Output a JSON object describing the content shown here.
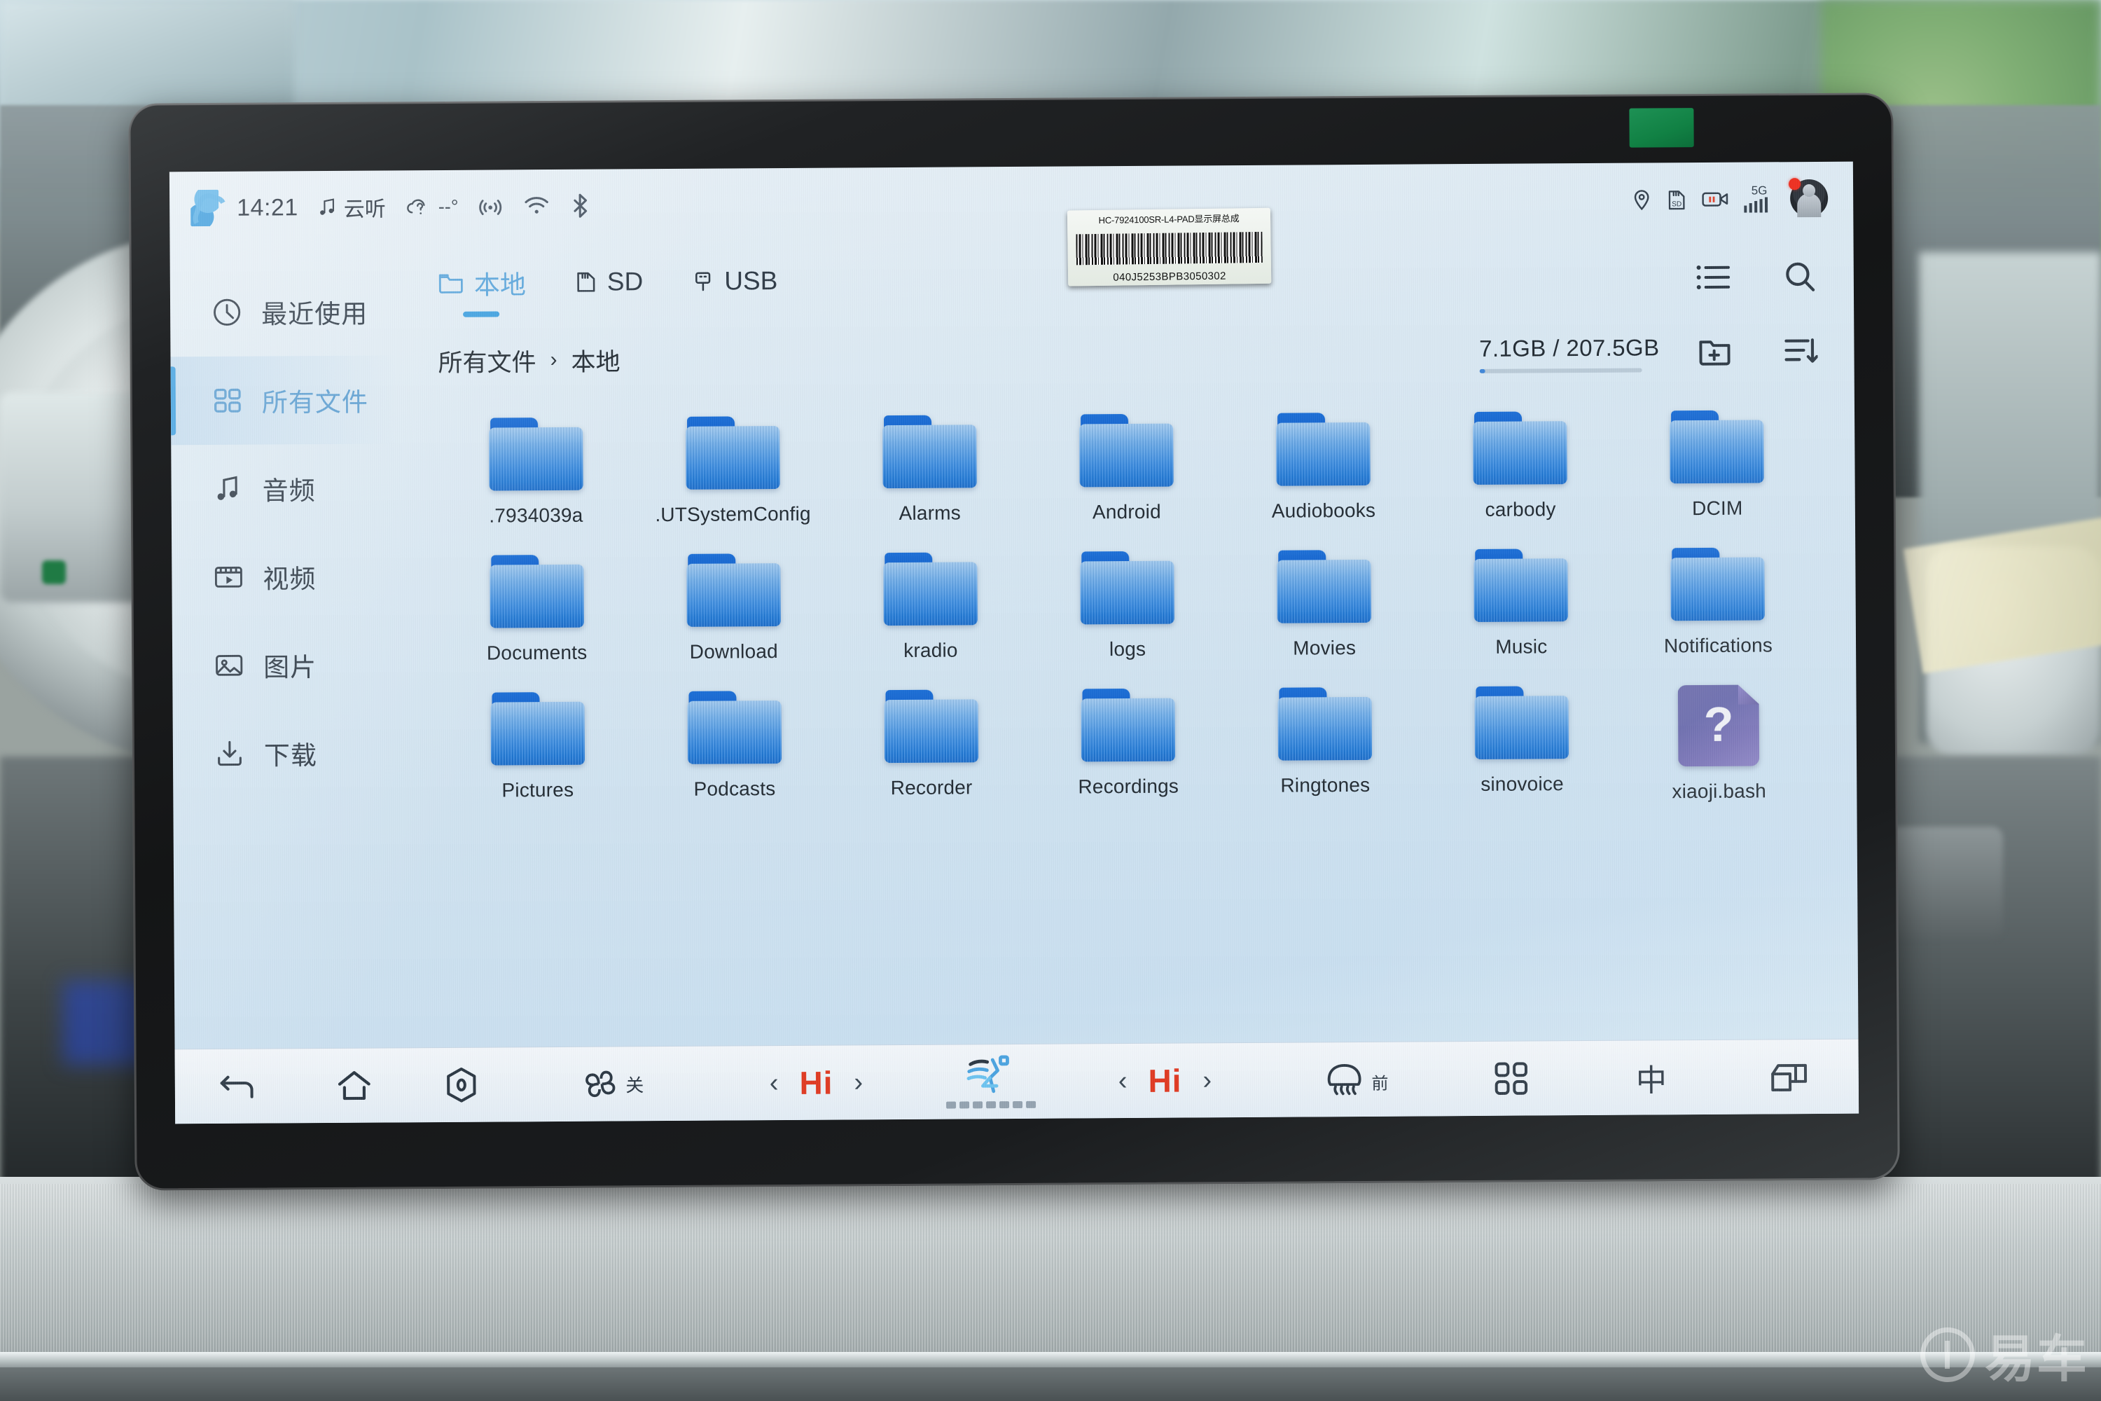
{
  "status_bar": {
    "logo_icon": "s-brand-logo-icon",
    "time": "14:21",
    "music_icon": "music-note-icon",
    "music_label": "云听",
    "weather_icon": "cloud-unknown-icon",
    "temperature": "--°",
    "broadcast_icon": "broadcast-icon",
    "wifi_icon": "wifi-icon",
    "bluetooth_icon": "bluetooth-off-icon",
    "location_icon": "location-pin-icon",
    "sdcard_icon": "sd-card-icon",
    "dashcam_icon": "dashcam-paused-icon",
    "network_label": "5G",
    "signal_icon": "signal-bars-icon",
    "avatar_icon": "user-avatar-icon",
    "avatar_badge": "notification-dot"
  },
  "sidebar": {
    "items": [
      {
        "label": "最近使用",
        "icon": "clock-icon",
        "active": false
      },
      {
        "label": "所有文件",
        "icon": "grid-icon",
        "active": true
      },
      {
        "label": "音频",
        "icon": "music-note-icon",
        "active": false
      },
      {
        "label": "视频",
        "icon": "video-film-icon",
        "active": false
      },
      {
        "label": "图片",
        "icon": "image-icon",
        "active": false
      },
      {
        "label": "下载",
        "icon": "download-icon",
        "active": false
      }
    ]
  },
  "tabs": [
    {
      "label": "本地",
      "icon": "folder-icon",
      "active": true
    },
    {
      "label": "SD",
      "icon": "sd-card-icon",
      "active": false
    },
    {
      "label": "USB",
      "icon": "usb-icon",
      "active": false
    }
  ],
  "toolbar": {
    "list_view_icon": "list-view-icon",
    "search_icon": "search-icon",
    "new_folder_icon": "new-folder-icon",
    "sort_icon": "sort-descending-icon"
  },
  "breadcrumb": {
    "root": "所有文件",
    "separator": "›",
    "current": "本地"
  },
  "storage": {
    "text": "7.1GB / 207.5GB",
    "used_gb": 7.1,
    "total_gb": 207.5,
    "percent": 3.4,
    "fill_color": "#3f86d8"
  },
  "files": [
    {
      "name": ".7934039a",
      "type": "folder"
    },
    {
      "name": ".UTSystemConfig",
      "type": "folder"
    },
    {
      "name": "Alarms",
      "type": "folder"
    },
    {
      "name": "Android",
      "type": "folder"
    },
    {
      "name": "Audiobooks",
      "type": "folder"
    },
    {
      "name": "carbody",
      "type": "folder"
    },
    {
      "name": "DCIM",
      "type": "folder"
    },
    {
      "name": "Documents",
      "type": "folder"
    },
    {
      "name": "Download",
      "type": "folder"
    },
    {
      "name": "kradio",
      "type": "folder"
    },
    {
      "name": "logs",
      "type": "folder"
    },
    {
      "name": "Movies",
      "type": "folder"
    },
    {
      "name": "Music",
      "type": "folder"
    },
    {
      "name": "Notifications",
      "type": "folder"
    },
    {
      "name": "Pictures",
      "type": "folder"
    },
    {
      "name": "Podcasts",
      "type": "folder"
    },
    {
      "name": "Recorder",
      "type": "folder"
    },
    {
      "name": "Recordings",
      "type": "folder"
    },
    {
      "name": "Ringtones",
      "type": "folder"
    },
    {
      "name": "sinovoice",
      "type": "folder"
    },
    {
      "name": "xiaoji.bash",
      "type": "unknown-file"
    }
  ],
  "bottom_bar": {
    "back_icon": "back-arrow-icon",
    "home_icon": "home-icon",
    "power_icon": "power-hexagon-icon",
    "fan_icon": "fan-icon",
    "fan_label": "关",
    "temp_left": {
      "prev_icon": "chevron-left-icon",
      "value": "Hi",
      "next_icon": "chevron-right-icon"
    },
    "seat_airflow_icon": "seat-airflow-icon",
    "seat_level_segments": 7,
    "temp_right": {
      "prev_icon": "chevron-left-icon",
      "value": "Hi",
      "next_icon": "chevron-right-icon"
    },
    "defrost_icon": "front-defrost-icon",
    "defrost_label": "前",
    "apps_icon": "app-grid-icon",
    "ime_label": "中",
    "split_screen_icon": "split-screen-icon"
  },
  "device_label": {
    "model": "HC-7924100SR-L4-PAD显示屏总成",
    "serial": "040J5253BPB3050302"
  },
  "watermark": {
    "text": "易车"
  },
  "colors": {
    "accent": "#3ea0e0",
    "folder_blue": "#1f7ada",
    "temp_red": "#e03a22",
    "screen_bg": "#d7e9f4"
  }
}
